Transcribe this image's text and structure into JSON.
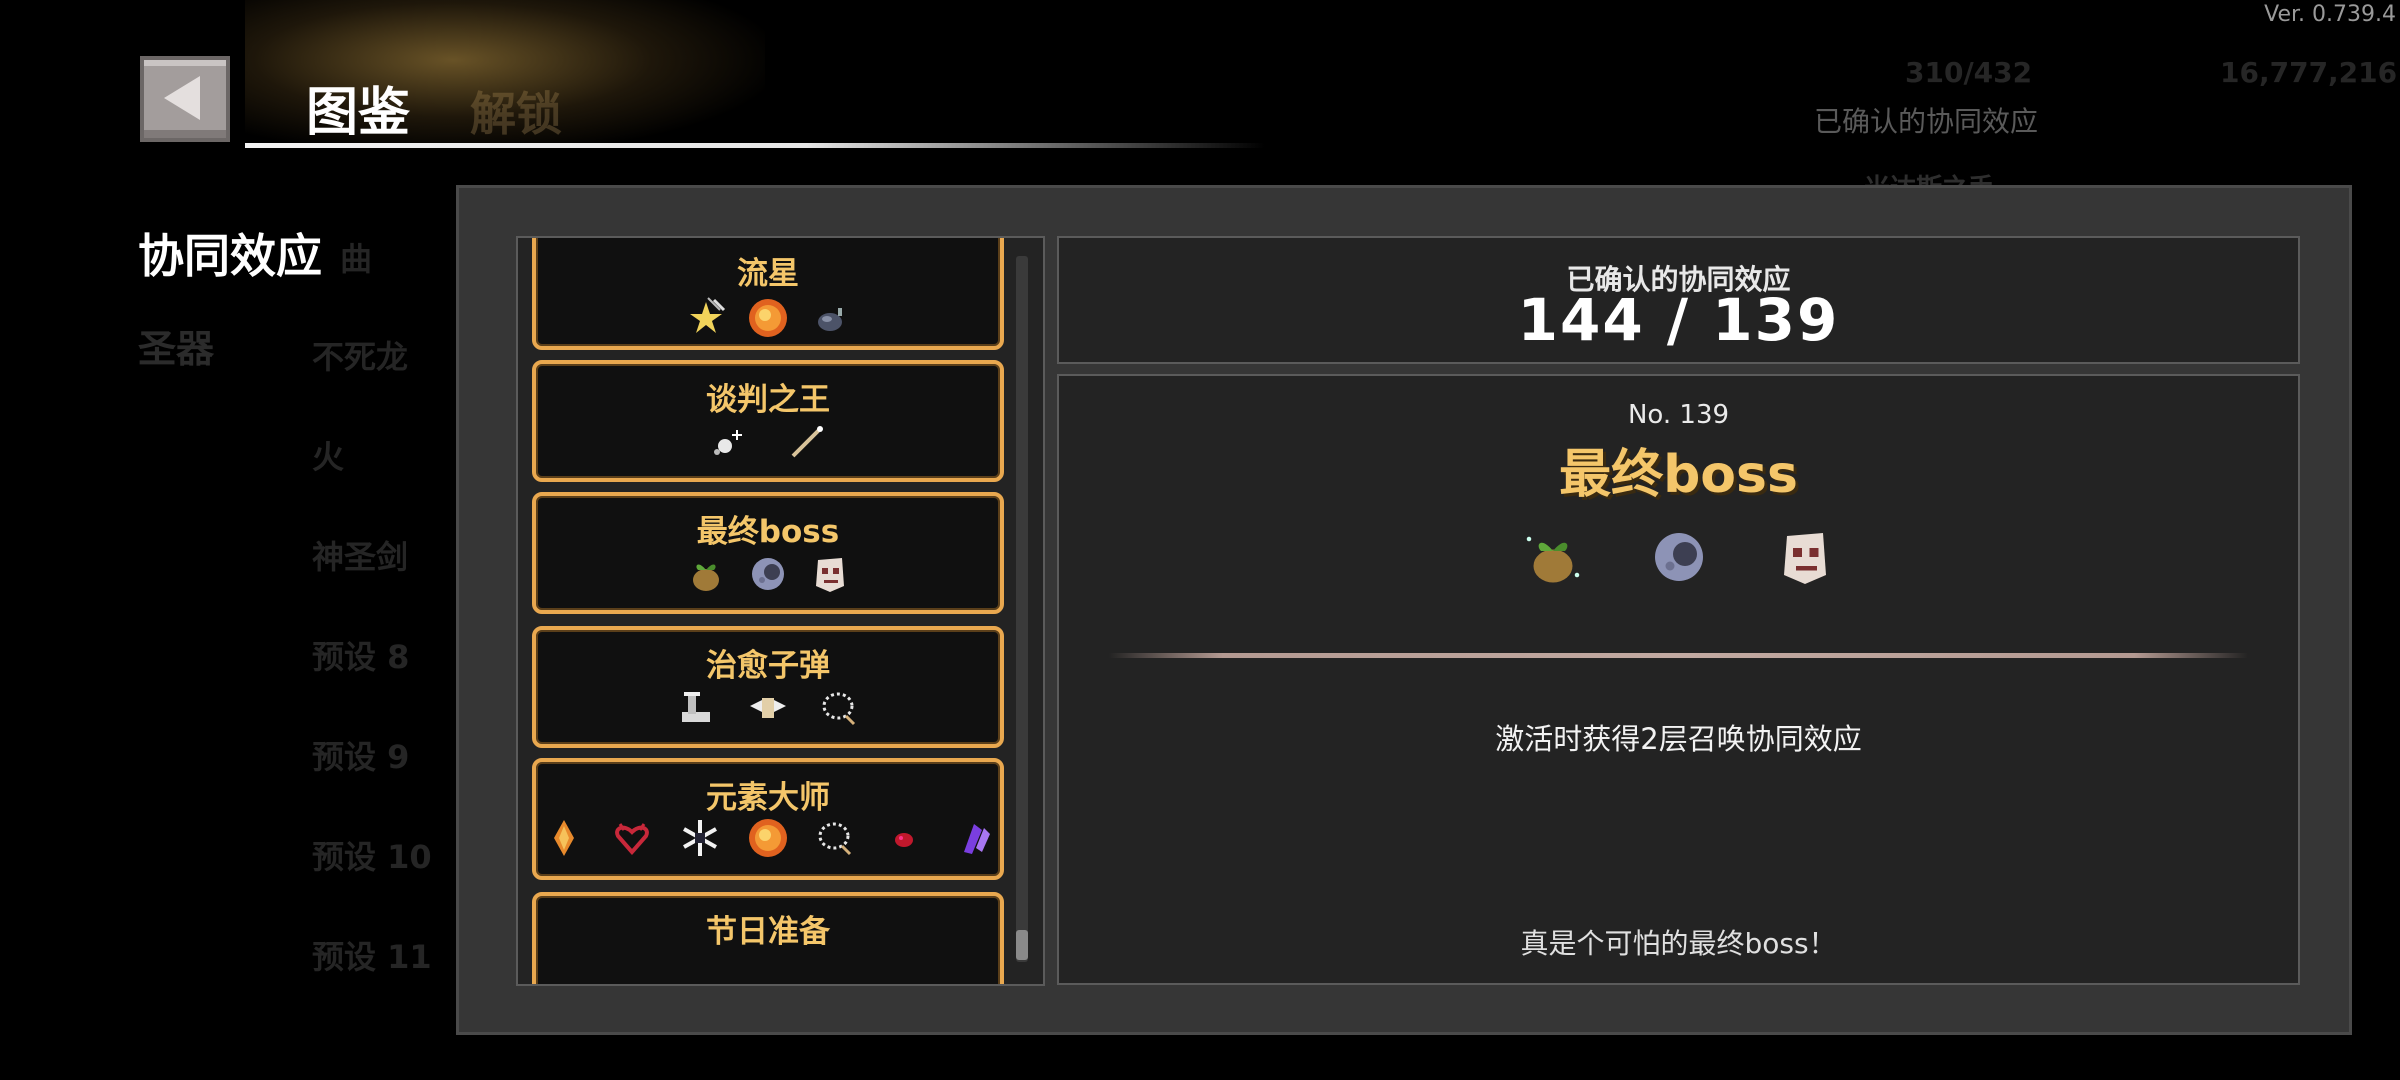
{
  "version": "Ver. 0.739.4",
  "header": {
    "title": "图鉴"
  },
  "background": {
    "ghost_tab": "解锁",
    "currency_a": "310/432",
    "currency_b": "16,777,216",
    "confirmed_label": "已确认的协同效应",
    "ghost_card": "米达斯之手",
    "ghost_items": [
      "曲",
      "不死龙",
      "火",
      "神圣剑",
      "预设 8",
      "预设 9",
      "预设 10",
      "预设 11"
    ]
  },
  "categories": [
    {
      "label": "协同效应",
      "active": true
    },
    {
      "label": "圣器",
      "active": false
    }
  ],
  "synergy_list": [
    {
      "name": "流星",
      "icons": [
        "shooting-star-icon",
        "fireball-icon",
        "rock-bomb-icon"
      ]
    },
    {
      "name": "谈判之王",
      "icons": [
        "sparkle-orb-icon",
        "wand-icon"
      ]
    },
    {
      "name": "最终boss",
      "icons": [
        "seed-sprout-icon",
        "moon-orb-icon",
        "skull-mask-icon"
      ]
    },
    {
      "name": "治愈子弹",
      "icons": [
        "faucet-icon",
        "winged-scroll-icon",
        "rosary-icon"
      ]
    },
    {
      "name": "元素大师",
      "icons": [
        "flame-crystal-icon",
        "demon-heart-icon",
        "snowflake-icon",
        "fireball-icon",
        "rosary-icon",
        "blood-drop-icon",
        "purple-crystal-icon"
      ]
    },
    {
      "name": "节日准备",
      "icons": []
    }
  ],
  "summary": {
    "label": "已确认的协同效应",
    "count": "144 / 139"
  },
  "detail": {
    "number": "No. 139",
    "name": "最终boss",
    "icons": [
      "seed-sprout-icon",
      "moon-orb-icon",
      "skull-mask-icon"
    ],
    "description": "激活时获得2层召唤协同效应",
    "flavor": "真是个可怕的最终boss！"
  },
  "colors": {
    "accent_gold": "#f4c66a",
    "card_border": "#e9a84f",
    "panel_bg": "#363636",
    "inner_bg": "#232323"
  }
}
